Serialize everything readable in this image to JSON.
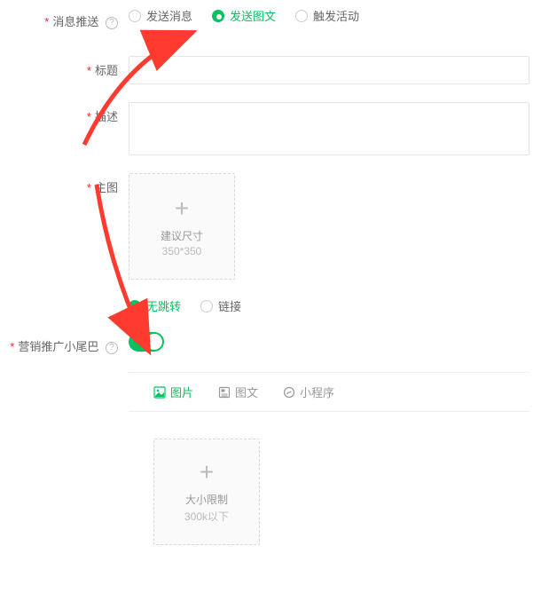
{
  "colors": {
    "accent": "#07c160",
    "danger": "#f5222d"
  },
  "message_push": {
    "label": "消息推送",
    "options": [
      "发送消息",
      "发送图文",
      "触发活动"
    ],
    "selected": 1
  },
  "title": {
    "label": "标题",
    "value": ""
  },
  "desc": {
    "label": "描述",
    "value": ""
  },
  "main_image": {
    "label": "主图",
    "hint1": "建议尺寸",
    "hint2": "350*350"
  },
  "jump": {
    "options": [
      "无跳转",
      "链接"
    ],
    "selected": 0
  },
  "promo_tail": {
    "label": "营销推广小尾巴",
    "on": true
  },
  "tabs": {
    "items": [
      "图片",
      "图文",
      "小程序"
    ],
    "active": 0
  },
  "promo_image": {
    "hint1": "大小限制",
    "hint2": "300k以下"
  }
}
